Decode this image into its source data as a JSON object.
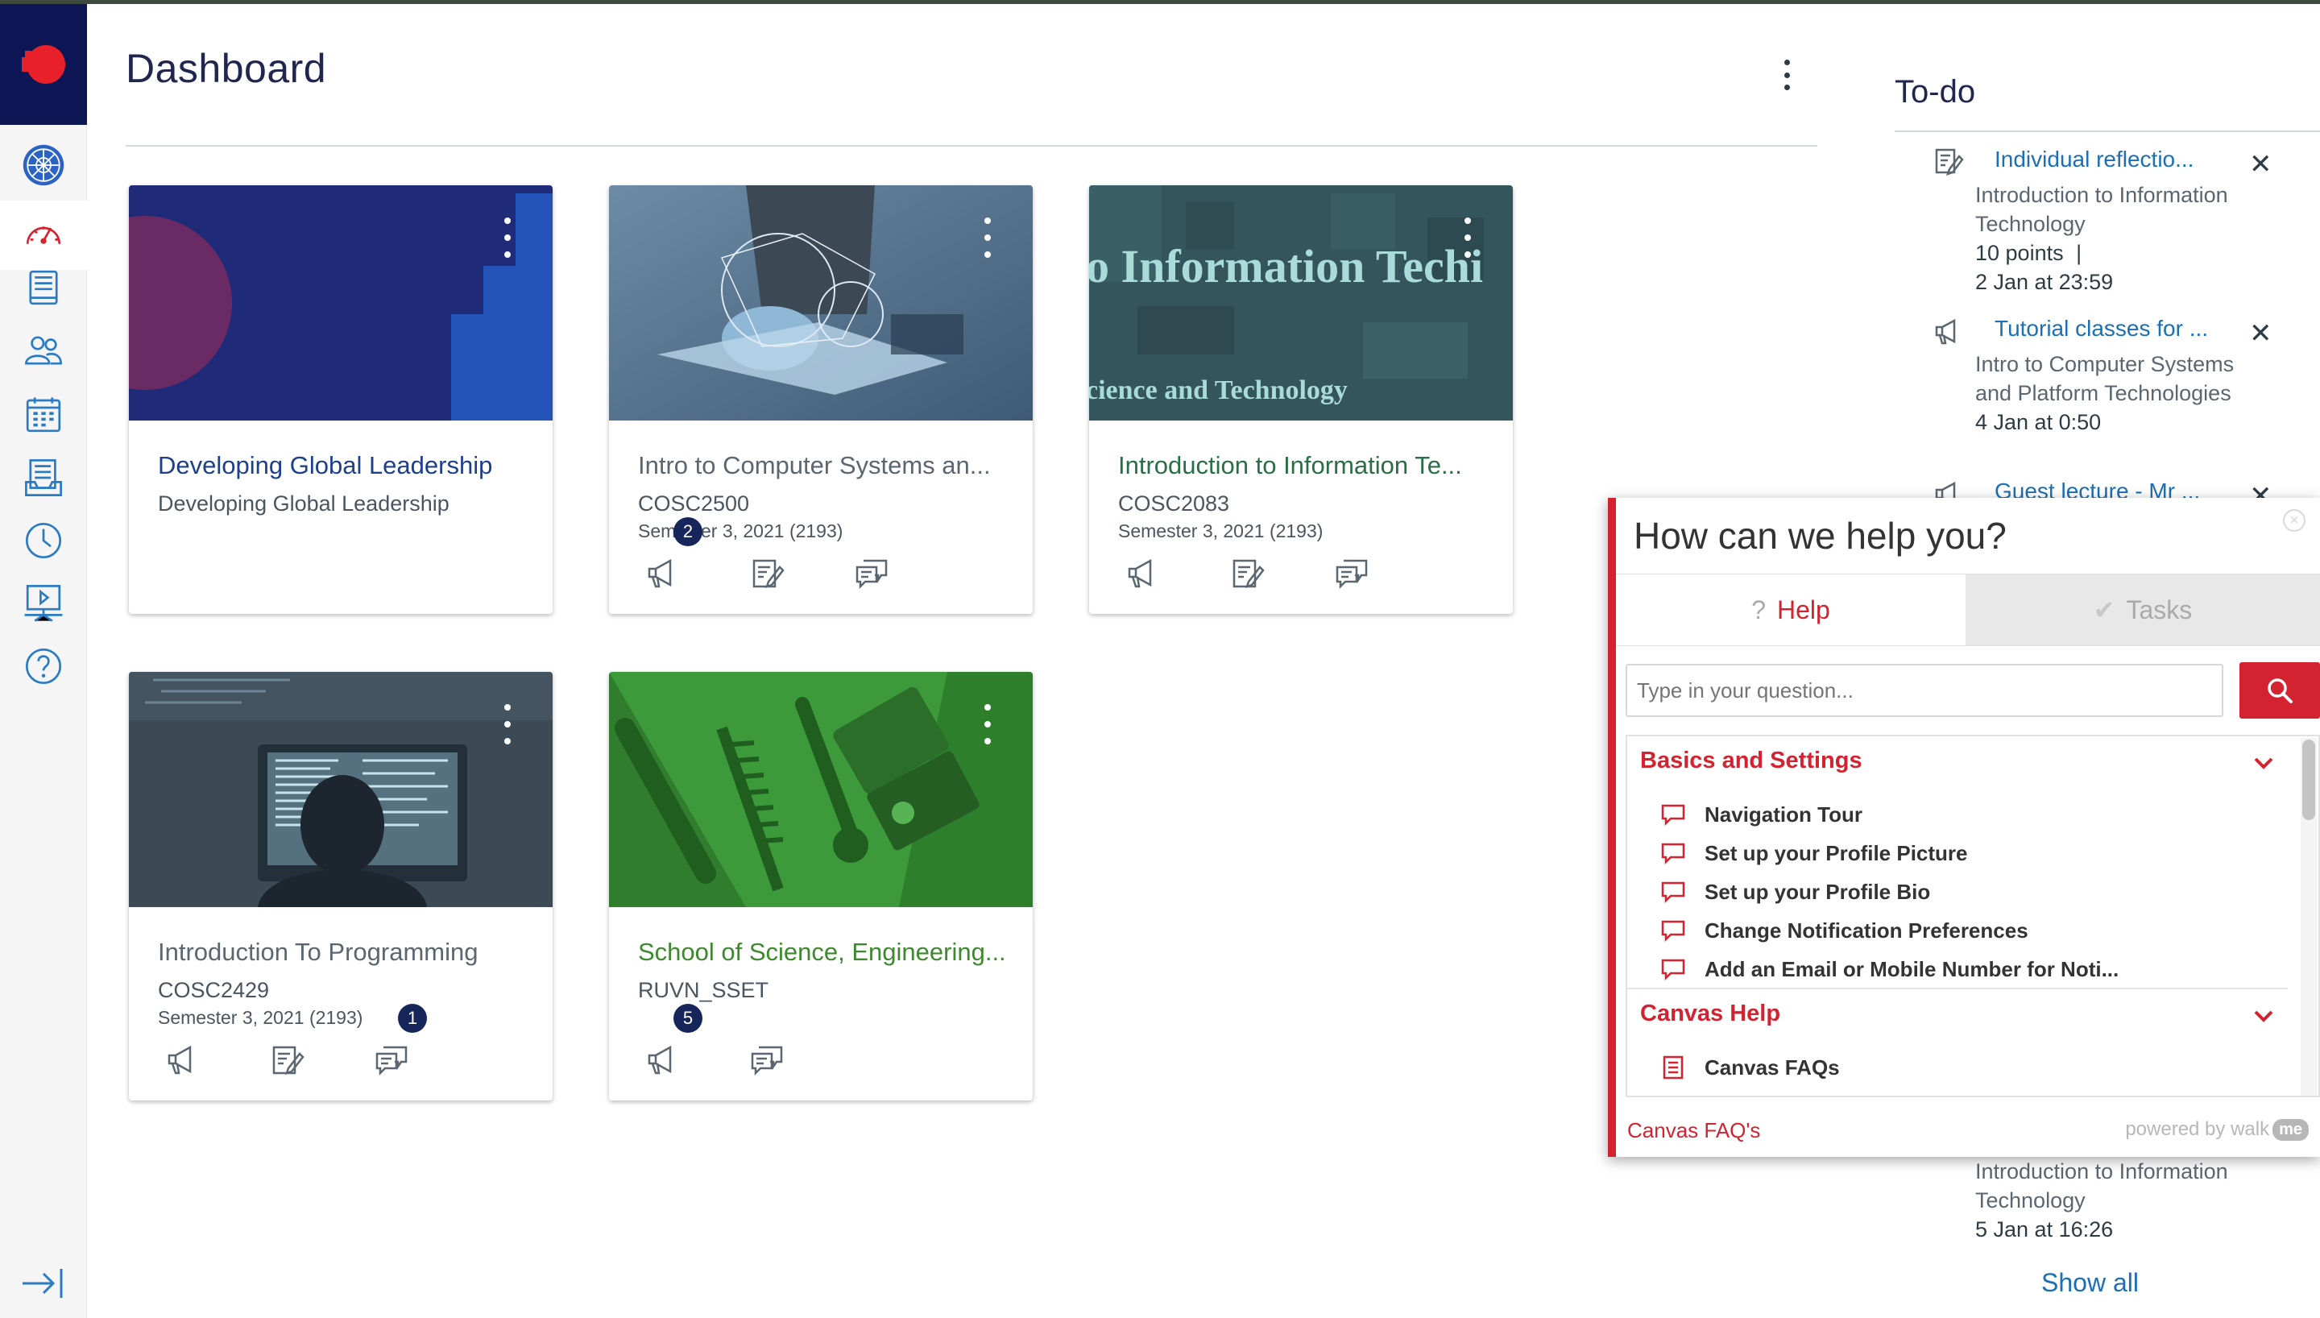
{
  "page": {
    "title": "Dashboard"
  },
  "colors": {
    "nav_brand": "#0c1654",
    "accent_red": "#d32330",
    "link_blue": "#1b6fb5",
    "badge": "#17265a"
  },
  "global_nav": {
    "items": [
      {
        "name": "logo",
        "icon": "institution-logo-icon"
      },
      {
        "name": "account",
        "icon": "account-avatar-icon"
      },
      {
        "name": "dashboard",
        "icon": "dashboard-gauge-icon",
        "active": true
      },
      {
        "name": "courses",
        "icon": "courses-book-icon"
      },
      {
        "name": "groups",
        "icon": "groups-people-icon"
      },
      {
        "name": "calendar",
        "icon": "calendar-icon"
      },
      {
        "name": "inbox",
        "icon": "inbox-icon"
      },
      {
        "name": "history",
        "icon": "history-clock-icon"
      },
      {
        "name": "studio",
        "icon": "studio-presentation-icon"
      },
      {
        "name": "help",
        "icon": "help-question-icon"
      }
    ],
    "collapse_icon": "collapse-nav-icon"
  },
  "cards": [
    {
      "title": "Developing Global Leadership",
      "code": "Developing Global Leadership",
      "term": "",
      "title_color": "#1e3f8a",
      "actions": []
    },
    {
      "title": "Intro to Computer Systems an...",
      "code": "COSC2500",
      "term": "Semester 3, 2021 (2193)",
      "title_color": "#5a6670",
      "announcement_badge": "2",
      "actions": [
        "announcements",
        "assignments",
        "discussions"
      ]
    },
    {
      "title": "Introduction to Information Te...",
      "code": "COSC2083",
      "term": "Semester 3, 2021 (2193)",
      "title_color": "#2a6e45",
      "hero_text_1": "o Information Techi",
      "hero_text_2": "cience and Technology",
      "actions": [
        "announcements",
        "assignments",
        "discussions"
      ]
    },
    {
      "title": "Introduction To Programming",
      "code": "COSC2429",
      "term": "Semester 3, 2021 (2193)",
      "title_color": "#5a6670",
      "discussion_badge": "1",
      "actions": [
        "announcements",
        "assignments",
        "discussions"
      ]
    },
    {
      "title": "School of Science, Engineering...",
      "code": "RUVN_SSET",
      "term": "",
      "title_color": "#3d8a2e",
      "announcement_badge": "5",
      "actions": [
        "announcements",
        "discussions"
      ]
    }
  ],
  "todo": {
    "title": "To-do",
    "items": [
      {
        "icon": "assignment-icon",
        "link": "Individual reflectio...",
        "course": "Introduction to Information Technology",
        "points": "10 points",
        "separator": "|",
        "due": "2 Jan at 23:59"
      },
      {
        "icon": "announcement-icon",
        "link": "Tutorial classes for ...",
        "course": "Intro to Computer Systems and Platform Technologies",
        "due": "4 Jan at 0:50"
      },
      {
        "icon": "announcement-icon",
        "link": "Guest lecture - Mr ..."
      }
    ],
    "tail": {
      "course": "Introduction to Information Technology",
      "due": "5 Jan at 16:26"
    },
    "show_all": "Show all",
    "dismiss_label": "✕"
  },
  "help_widget": {
    "title": "How can we help you?",
    "tabs": {
      "help": "Help",
      "tasks": "Tasks"
    },
    "search": {
      "placeholder": "Type in your question..."
    },
    "sections": [
      {
        "name": "Basics and Settings",
        "items": [
          "Navigation Tour",
          "Set up your Profile Picture",
          "Set up your Profile Bio",
          "Change Notification Preferences",
          "Add an Email or Mobile Number for Noti..."
        ]
      },
      {
        "name": "Canvas Help",
        "items": [
          "Canvas FAQs"
        ]
      }
    ],
    "footer_link": "Canvas FAQ's",
    "powered_by": "powered by walk",
    "powered_me": "me"
  }
}
